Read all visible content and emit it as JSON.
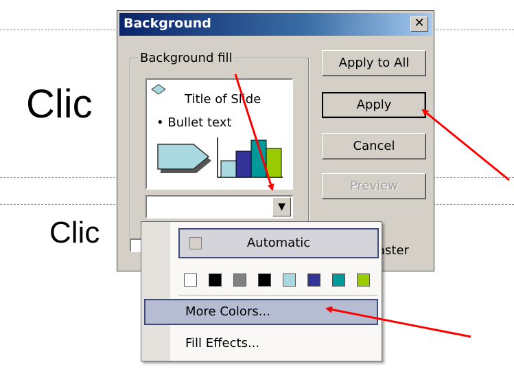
{
  "slide": {
    "title_fragment": "Clic",
    "subtitle_fragment": "Clic"
  },
  "dialog": {
    "title": "Background",
    "close_glyph": "✕",
    "group_label": "Background fill",
    "preview": {
      "title": "Title of Slide",
      "bullet": "• Bullet text"
    },
    "combo_arrow": "▼",
    "buttons": {
      "apply_all": "Apply to All",
      "apply": "Apply",
      "cancel": "Cancel",
      "preview": "Preview"
    },
    "omit_label_fragment": "aster"
  },
  "color_menu": {
    "automatic_label": "Automatic",
    "swatches": [
      "#ffffff",
      "#000000",
      "#808080",
      "#000000",
      "#a8d8e0",
      "#333399",
      "#009999",
      "#99cc00"
    ],
    "more_colors": "More Colors...",
    "fill_effects": "Fill Effects..."
  },
  "colors": {
    "annotation_arrow": "#ff0000",
    "titlebar": "#0a246a"
  }
}
